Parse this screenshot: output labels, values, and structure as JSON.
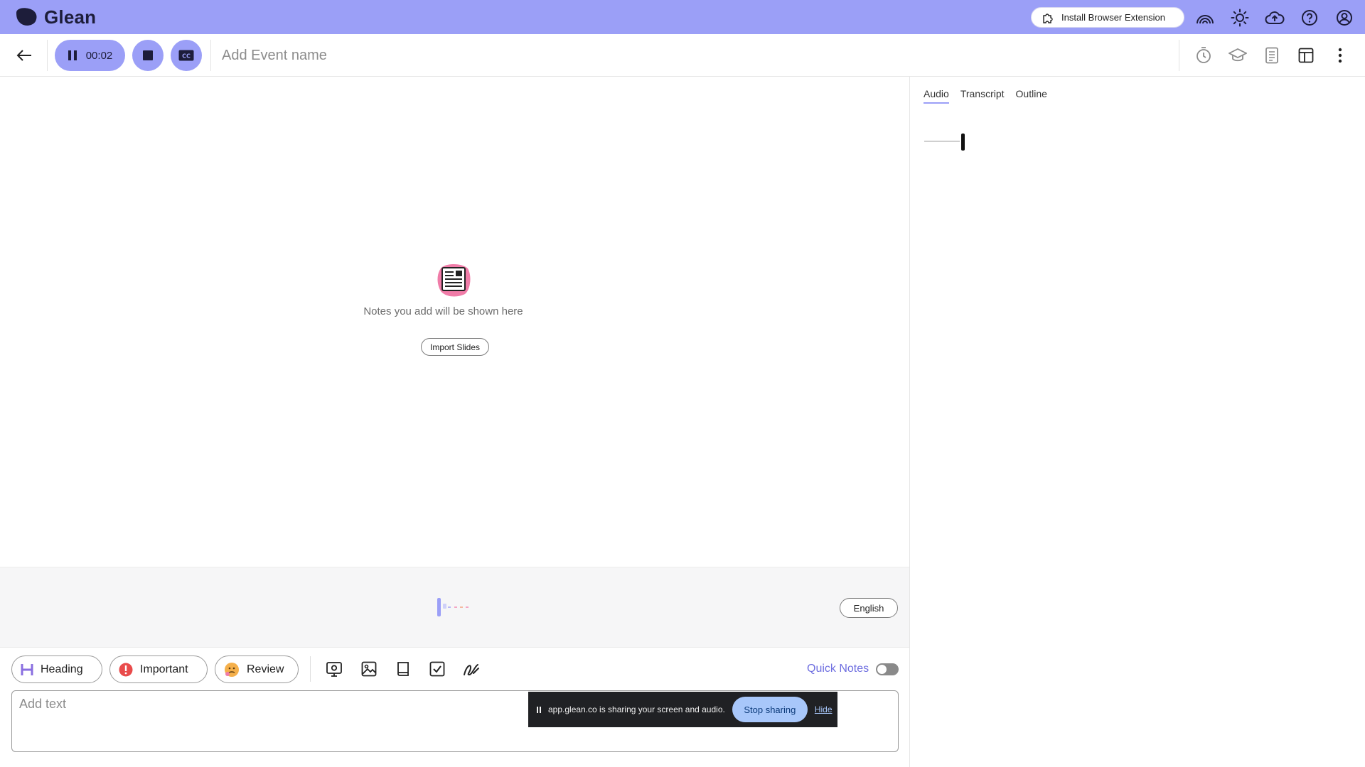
{
  "app": {
    "name": "Glean",
    "brand_color": "#9b9ff7",
    "install_extension_label": "Install Browser Extension"
  },
  "top_icons": [
    "rainbow-icon",
    "sun-icon",
    "cloud-upload-icon",
    "help-icon",
    "account-icon"
  ],
  "toolbar": {
    "timer": "00:02",
    "event_name_placeholder": "Add Event name",
    "cc_label": "CC",
    "right_tools": [
      "timer-icon",
      "graduation-cap-icon",
      "document-icon",
      "layout-icon",
      "more-vertical-icon"
    ]
  },
  "notes": {
    "empty_message": "Notes you add will be shown here",
    "import_slides_label": "Import Slides"
  },
  "caption": {
    "language": "English"
  },
  "tags": {
    "heading": "Heading",
    "important": "Important",
    "review": "Review"
  },
  "insert_tools": [
    "screenshot-icon",
    "image-icon",
    "book-icon",
    "checkbox-icon",
    "draw-icon"
  ],
  "quick_notes": {
    "label": "Quick Notes",
    "enabled": false
  },
  "text_input": {
    "placeholder": "Add text"
  },
  "share_notice": {
    "message": "app.glean.co is sharing your screen and audio.",
    "stop_label": "Stop sharing",
    "hide_label": "Hide"
  },
  "right_panel": {
    "tabs": [
      "Audio",
      "Transcript",
      "Outline"
    ],
    "active_tab": "Audio"
  }
}
